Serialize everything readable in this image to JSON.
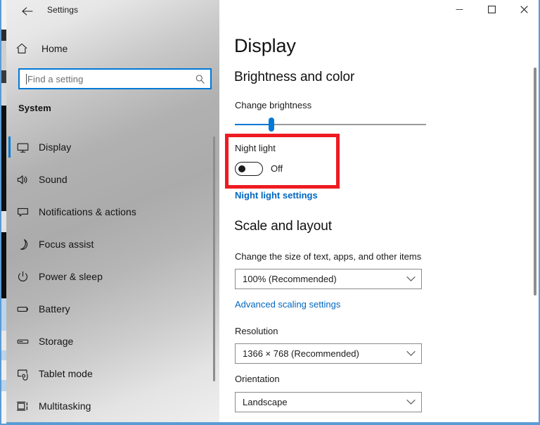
{
  "window": {
    "title": "Settings",
    "back_icon": "back-arrow-icon",
    "controls": {
      "minimize": "minimize-icon",
      "maximize": "maximize-icon",
      "close": "close-icon"
    }
  },
  "sidebar": {
    "home": {
      "label": "Home",
      "icon": "home-icon"
    },
    "search": {
      "value": "",
      "placeholder": "Find a setting",
      "icon": "search-icon"
    },
    "group_title": "System",
    "items": [
      {
        "label": "Display",
        "icon": "monitor-icon",
        "selected": true
      },
      {
        "label": "Sound",
        "icon": "speaker-icon",
        "selected": false
      },
      {
        "label": "Notifications & actions",
        "icon": "notification-icon",
        "selected": false
      },
      {
        "label": "Focus assist",
        "icon": "moon-icon",
        "selected": false
      },
      {
        "label": "Power & sleep",
        "icon": "power-icon",
        "selected": false
      },
      {
        "label": "Battery",
        "icon": "battery-icon",
        "selected": false
      },
      {
        "label": "Storage",
        "icon": "storage-icon",
        "selected": false
      },
      {
        "label": "Tablet mode",
        "icon": "tablet-icon",
        "selected": false
      },
      {
        "label": "Multitasking",
        "icon": "multitasking-icon",
        "selected": false
      }
    ]
  },
  "main": {
    "page_title": "Display",
    "brightness_section": {
      "heading": "Brightness and color",
      "change_brightness_label": "Change brightness",
      "brightness_percent": 19,
      "night_light_label": "Night light",
      "night_light_state": "Off",
      "night_light_on": false,
      "night_light_settings_link": "Night light settings"
    },
    "scale_section": {
      "heading": "Scale and layout",
      "scale_label": "Change the size of text, apps, and other items",
      "scale_value": "100% (Recommended)",
      "advanced_scaling_link": "Advanced scaling settings",
      "resolution_label": "Resolution",
      "resolution_value": "1366 × 768 (Recommended)",
      "orientation_label": "Orientation",
      "orientation_value": "Landscape"
    }
  },
  "annotation": {
    "shape": "rectangle",
    "color": "#ee1b22",
    "target": "night-light-toggle"
  },
  "colors": {
    "accent": "#0078d7",
    "link": "#0067c0",
    "annotation_red": "#ee1b22",
    "window_border": "#5a9bd5",
    "text": "#1b1b1b"
  }
}
